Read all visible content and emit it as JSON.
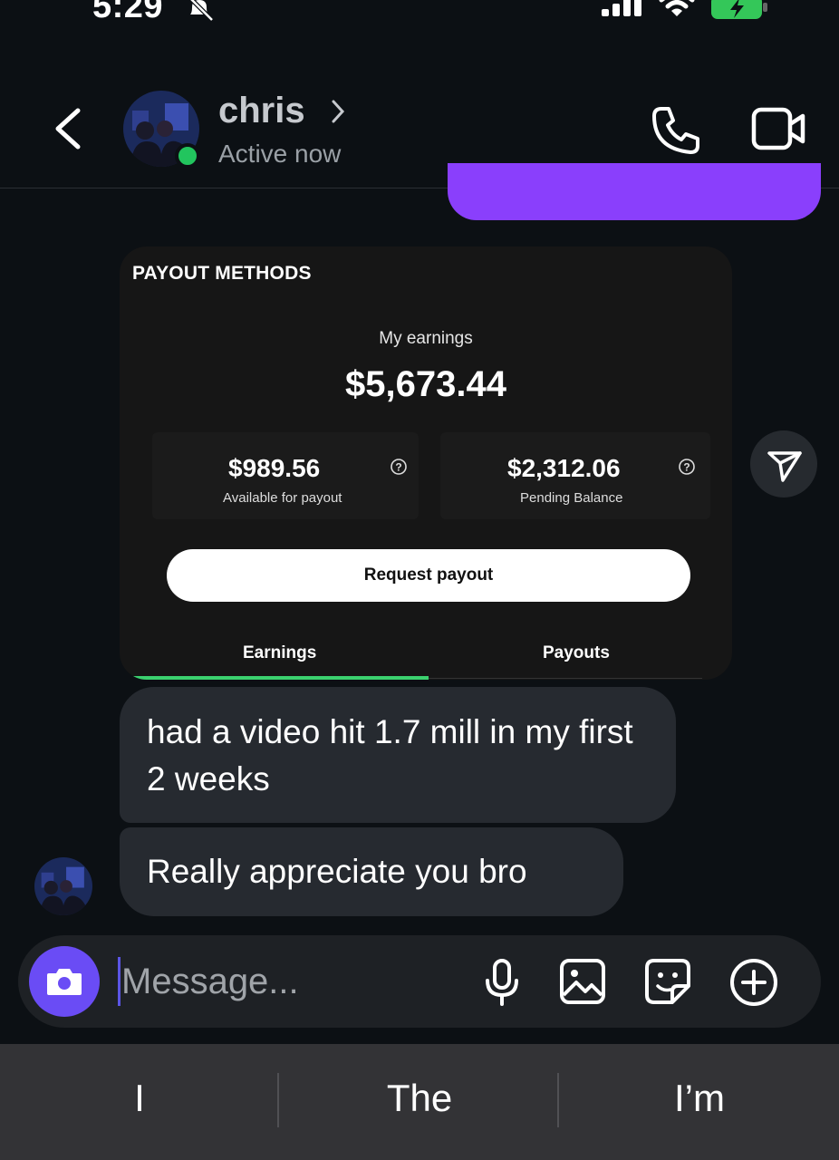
{
  "status_bar": {
    "time": "5:29"
  },
  "header": {
    "contact_name": "chris",
    "status": "Active now"
  },
  "payout_card": {
    "heading": "PAYOUT METHODS",
    "earnings_label": "My earnings",
    "earnings_amount": "$5,673.44",
    "available_amount": "$989.56",
    "available_label": "Available for payout",
    "pending_amount": "$2,312.06",
    "pending_label": "Pending Balance",
    "request_button": "Request payout",
    "tabs": [
      {
        "label": "Earnings",
        "active": true
      },
      {
        "label": "Payouts",
        "active": false
      }
    ]
  },
  "messages": [
    {
      "text": "had a video hit 1.7 mill in my first 2 weeks"
    },
    {
      "text": "Really appreciate you bro"
    }
  ],
  "composer": {
    "placeholder": "Message..."
  },
  "keyboard_suggestions": [
    "I",
    "The",
    "I’m"
  ],
  "colors": {
    "sent_bubble": "#8a3ffc",
    "received_bubble": "#262a30",
    "online": "#22c55e",
    "camera_button": "#6a4cf5",
    "tab_active": "#3bd16f"
  }
}
